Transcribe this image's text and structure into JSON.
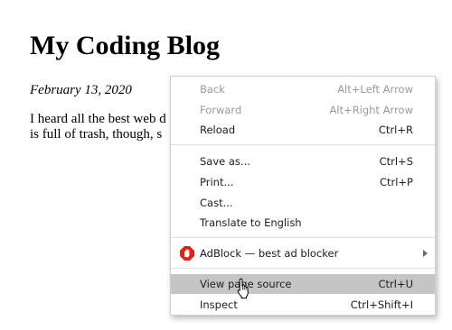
{
  "page": {
    "title": "My Coding Blog",
    "date": "February 13, 2020",
    "body_line1": "I heard all the best web d",
    "body_line2": "is full of trash, though, s"
  },
  "context_menu": {
    "items": [
      {
        "label": "Back",
        "shortcut": "Alt+Left Arrow",
        "enabled": false
      },
      {
        "label": "Forward",
        "shortcut": "Alt+Right Arrow",
        "enabled": false
      },
      {
        "label": "Reload",
        "shortcut": "Ctrl+R",
        "enabled": true
      },
      {
        "label": "Save as...",
        "shortcut": "Ctrl+S",
        "enabled": true
      },
      {
        "label": "Print...",
        "shortcut": "Ctrl+P",
        "enabled": true
      },
      {
        "label": "Cast...",
        "shortcut": "",
        "enabled": true
      },
      {
        "label": "Translate to English",
        "shortcut": "",
        "enabled": true
      },
      {
        "label": "AdBlock — best ad blocker",
        "shortcut": "",
        "enabled": true,
        "icon": "adblock-icon",
        "submenu": true
      },
      {
        "label": "View page source",
        "shortcut": "Ctrl+U",
        "enabled": true,
        "highlighted": true
      },
      {
        "label": "Inspect",
        "shortcut": "Ctrl+Shift+I",
        "enabled": true
      }
    ]
  },
  "colors": {
    "menu_hover": "#c5c5c5",
    "disabled_text": "#9a9a9a",
    "adblock_red": "#e2231a"
  }
}
